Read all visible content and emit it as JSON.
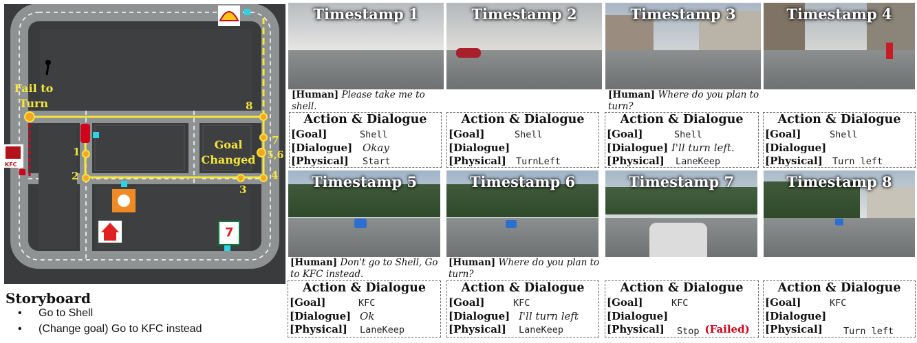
{
  "map": {
    "fail_label_1": "Fail to",
    "fail_label_2": "Turn",
    "goal_label_1": "Goal",
    "goal_label_2": "Changed",
    "waypoints": [
      "1",
      "2",
      "3",
      "4",
      "5,6",
      "7",
      "8"
    ],
    "kfc_logo_text": "KFC"
  },
  "storyboard": {
    "title": "Storyboard",
    "items": [
      "Go to Shell",
      "(Change goal) Go to KFC instead"
    ]
  },
  "panels": [
    {
      "label": "Timestamp 1",
      "human_tag": "[Human]",
      "human_text": "Please take me to shell."
    },
    {
      "label": "Timestamp 2"
    },
    {
      "label": "Timestamp 3",
      "human_tag": "[Human]",
      "human_text": "Where do you plan to turn?"
    },
    {
      "label": "Timestamp 4"
    },
    {
      "label": "Timestamp 5",
      "human_tag": "[Human]",
      "human_text": "Don't go to Shell, Go to KFC instead."
    },
    {
      "label": "Timestamp 6",
      "human_tag": "[Human]",
      "human_text": "Where do you plan to turn?"
    },
    {
      "label": "Timestamp 7"
    },
    {
      "label": "Timestamp 8"
    }
  ],
  "action_boxes": [
    {
      "title": "Action & Dialogue",
      "goal_key": "[Goal]",
      "goal": "Shell",
      "dialogue_key": "[Dialogue]",
      "dialogue": "Okay",
      "physical_key": "[Physical]",
      "physical": "Start",
      "failed": ""
    },
    {
      "title": "Action & Dialogue",
      "goal_key": "[Goal]",
      "goal": "Shell",
      "dialogue_key": "[Dialogue]",
      "dialogue": "",
      "physical_key": "[Physical]",
      "physical": "TurnLeft",
      "failed": ""
    },
    {
      "title": "Action & Dialogue",
      "goal_key": "[Goal]",
      "goal": "Shell",
      "dialogue_key": "[Dialogue]",
      "dialogue": "I'll turn left.",
      "physical_key": "[Physical]",
      "physical": "LaneKeep",
      "failed": ""
    },
    {
      "title": "Action & Dialogue",
      "goal_key": "[Goal]",
      "goal": "Shell",
      "dialogue_key": "[Dialogue]",
      "dialogue": "",
      "physical_key": "[Physical]",
      "physical": "Turn left",
      "failed": ""
    },
    {
      "title": "Action & Dialogue",
      "goal_key": "[Goal]",
      "goal": "KFC",
      "dialogue_key": "[Dialogue]",
      "dialogue": "Ok",
      "physical_key": "[Physical]",
      "physical": "LaneKeep",
      "failed": ""
    },
    {
      "title": "Action & Dialogue",
      "goal_key": "[Goal]",
      "goal": "KFC",
      "dialogue_key": "[Dialogue]",
      "dialogue": "I'll turn left",
      "physical_key": "[Physical]",
      "physical": "LaneKeep",
      "failed": ""
    },
    {
      "title": "Action & Dialogue",
      "goal_key": "[Goal]",
      "goal": "KFC",
      "dialogue_key": "[Dialogue]",
      "dialogue": "",
      "physical_key": "[Physical]",
      "physical": "Stop",
      "failed": "(Failed)"
    },
    {
      "title": "Action & Dialogue",
      "goal_key": "[Goal]",
      "goal": "KFC",
      "dialogue_key": "[Dialogue]",
      "dialogue": "",
      "physical_key": "[Physical]",
      "physical": "Turn left",
      "failed": ""
    }
  ]
}
